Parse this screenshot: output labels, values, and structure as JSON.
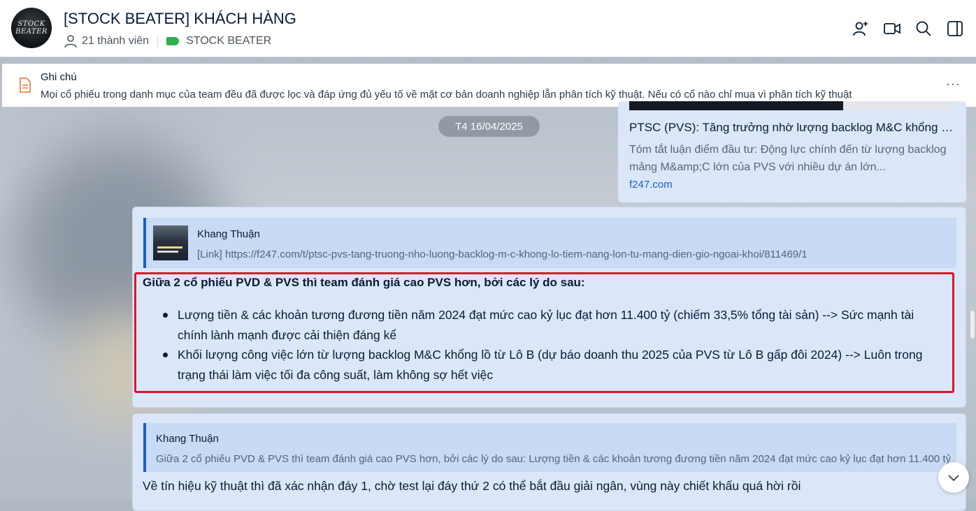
{
  "header": {
    "group_name": "[STOCK BEATER] KHÁCH HÀNG",
    "member_count": "21 thành viên",
    "tag_label": "STOCK BEATER",
    "avatar_line1": "STOCK",
    "avatar_line2": "BEATER",
    "icons": [
      "add-member-icon",
      "video-call-icon",
      "search-icon",
      "side-panel-icon"
    ]
  },
  "note": {
    "label": "Ghi chú",
    "text": "Mọi cổ phiếu trong danh mục của team đều đã được lọc và đáp ứng đủ yếu tố về mặt cơ bản doanh nghiệp lẫn phân tích kỹ thuật. Nếu có cổ nào chỉ mua vì phân tích kỹ thuật",
    "more": "···"
  },
  "date_separator": "T4 16/04/2025",
  "link_card": {
    "title": "PTSC (PVS): Tăng trưởng nhờ lượng backlog M&C khổng lồ, không lo tiềm năng lớn từ mảng điện gió ngoài khơi",
    "description": "Tóm tắt luận điểm đầu tư: Động lực chính đến từ lượng backlog mảng M&amp;C lớn của PVS với nhiều dự án lớn...",
    "domain": "f247.com"
  },
  "message1": {
    "quote_author": "Khang Thuận",
    "quote_text": "[Link] https://f247.com/t/ptsc-pvs-tang-truong-nho-luong-backlog-m-c-khong-lo-tiem-nang-lon-tu-mang-dien-gio-ngoai-khoi/811469/1",
    "heading": "Giữa 2 cổ phiếu PVD & PVS thì team đánh giá cao PVS hơn, bởi các lý do sau:",
    "bullets": [
      "Lượng tiền & các khoản tương đương tiền năm 2024 đạt mức cao kỷ lục đạt hơn 11.400 tỷ (chiếm 33,5% tổng tài sản) --> Sức mạnh tài chính lành mạnh được cải thiện đáng kể",
      "Khối lượng công việc lớn từ lượng backlog M&C khổng lồ từ Lô B (dự báo doanh thu 2025 của PVS từ Lô B gấp đôi 2024) --> Luôn trong trạng thái làm việc tối đa công suất, làm không sợ hết việc"
    ]
  },
  "message2": {
    "quote_author": "Khang Thuận",
    "quote_text": "Giữa 2 cổ phiếu PVD & PVS thì team đánh giá cao PVS hơn, bởi các lý do sau: Lượng tiền & các khoản tương đương tiền năm 2024 đạt mức cao kỷ lục đạt hơn 11.400 tỷ",
    "text": "Về tín hiệu kỹ thuật thì đã xác nhận đáy 1, chờ test lại đáy thứ 2 có thể bắt đầu giải ngân, vùng này chiết khấu quá hời rồi"
  }
}
